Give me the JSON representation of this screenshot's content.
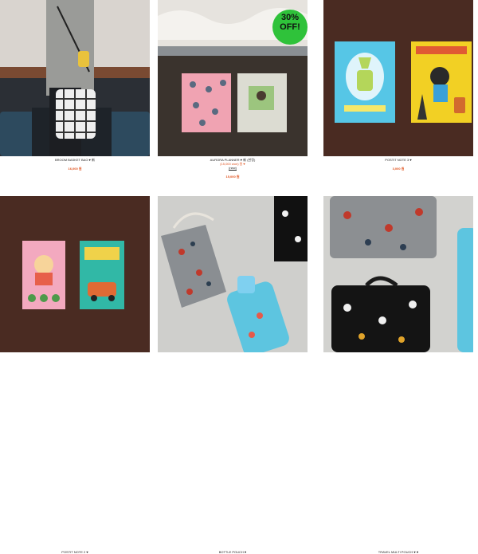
{
  "products": [
    {
      "name": "BROOM BASKET BAG ♥ 新",
      "price": "16,000 원",
      "image": "woman-with-checkered-bag"
    },
    {
      "name": "AURORA PLANNER ♥ 新 (한정)",
      "sale_price": "(15,000 won) 원 ♥",
      "label": "(new)",
      "price": "15,000 원",
      "badge": "30%\nOFF!",
      "image": "pink-and-grey-planners"
    },
    {
      "name": "POSTIT NOTE 3 ♥",
      "price": "3,000 원",
      "image": "blue-and-yellow-notebooks"
    },
    {
      "name": "POSTIT NOTE 2 ♥",
      "image": "pink-and-teal-notebooks"
    },
    {
      "name": "BOTTLE POUCH ♥",
      "image": "bottle-pouches"
    },
    {
      "name": "TRAVEL MULTI POUCH ♥ ♥",
      "image": "travel-multi-pouches"
    }
  ],
  "colors": {
    "accent": "#e0521d",
    "badge": "#2fc23a",
    "wood": "#4a2b22"
  }
}
